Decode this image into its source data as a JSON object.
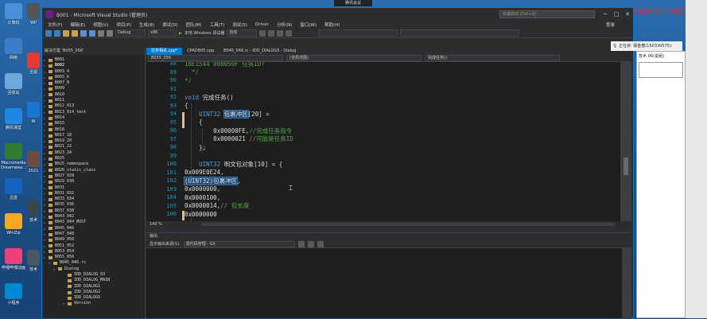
{
  "desktop": {
    "icons": [
      {
        "label": "计算机",
        "color": "#4a90d9"
      },
      {
        "label": "网络",
        "color": "#3d7cc9"
      },
      {
        "label": "回收站",
        "color": "#6fa8dc"
      },
      {
        "label": "腾讯课堂",
        "color": "#1e88e5"
      },
      {
        "label": "Macromedia Dreamwea...",
        "color": "#2e7d32"
      },
      {
        "label": "迅雷",
        "color": "#1565c0"
      },
      {
        "label": "WinZip",
        "color": "#f9a825"
      },
      {
        "label": "哔哩哔哩动画",
        "color": "#ec407a"
      },
      {
        "label": "小程序",
        "color": "#0288d1"
      }
    ],
    "icons2": [
      {
        "label": "WP",
        "color": "#555555"
      },
      {
        "label": "迅视",
        "color": "#e53935"
      },
      {
        "label": "W",
        "color": "#1976d2"
      },
      {
        "label": "2021",
        "color": "#6d4c41"
      },
      {
        "label": "技术",
        "color": "#37474f"
      },
      {
        "label": "技术",
        "color": "#455a64"
      }
    ]
  },
  "overlay": {
    "meeting": "腾讯会议",
    "qq": "QQ150330575"
  },
  "chat": {
    "text": "正在讲:",
    "name": "鄢金春(150330575):"
  },
  "winbox": {
    "title": "技术 0R(说组)"
  },
  "vs": {
    "title": "B001 - Microsoft Visual Studio (管理员)",
    "quick_launch": "快速启动 (Ctrl+Q)",
    "menu": [
      "文件(F)",
      "编辑(E)",
      "视图(V)",
      "项目(P)",
      "生成(B)",
      "调试(D)",
      "团队(M)",
      "工具(T)",
      "测试(S)",
      "Driver",
      "分析(N)",
      "窗口(W)",
      "帮助(H)"
    ],
    "login": "登录",
    "toolbar": {
      "config": "Debug",
      "platform": "x86",
      "debugger": "本地 Windows 调试器",
      "mode": "自动"
    },
    "solution": {
      "title": "解决方案 'B055_056'",
      "items": [
        {
          "text": "B001",
          "arrow": "▸",
          "bold": false
        },
        {
          "text": "B002",
          "arrow": "▸",
          "bold": true
        },
        {
          "text": "B003_4",
          "arrow": "▸",
          "bold": false
        },
        {
          "text": "B005_6",
          "arrow": "▸",
          "bold": false
        },
        {
          "text": "B007_8",
          "arrow": "▸",
          "bold": false
        },
        {
          "text": "B009",
          "arrow": "▸",
          "bold": false
        },
        {
          "text": "B010",
          "arrow": "▸",
          "bold": false
        },
        {
          "text": "B011",
          "arrow": "▸",
          "bold": false
        },
        {
          "text": "B012_013",
          "arrow": "▸",
          "bold": false
        },
        {
          "text": "B013_014_test",
          "arrow": "▸",
          "bold": false
        },
        {
          "text": "B014",
          "arrow": "▸",
          "bold": false
        },
        {
          "text": "B015",
          "arrow": "▸",
          "bold": false
        },
        {
          "text": "B016",
          "arrow": "▸",
          "bold": false
        },
        {
          "text": "B017_18",
          "arrow": "▸",
          "bold": false
        },
        {
          "text": "B019_20",
          "arrow": "▸",
          "bold": false
        },
        {
          "text": "B021_22",
          "arrow": "▸",
          "bold": false
        },
        {
          "text": "B023_24",
          "arrow": "▸",
          "bold": false
        },
        {
          "text": "B025",
          "arrow": "▸",
          "bold": false
        },
        {
          "text": "B025_namespace",
          "arrow": "▸",
          "bold": false
        },
        {
          "text": "B026_static_class",
          "arrow": "▸",
          "bold": false
        },
        {
          "text": "B027_028",
          "arrow": "▸",
          "bold": false
        },
        {
          "text": "B029_030",
          "arrow": "▸",
          "bold": false
        },
        {
          "text": "B031",
          "arrow": "▸",
          "bold": false
        },
        {
          "text": "B031_032",
          "arrow": "▸",
          "bold": false
        },
        {
          "text": "B033_034",
          "arrow": "▸",
          "bold": false
        },
        {
          "text": "B035_036",
          "arrow": "▸",
          "bold": false
        },
        {
          "text": "B037_038",
          "arrow": "▸",
          "bold": false
        },
        {
          "text": "B043_042",
          "arrow": "▸",
          "bold": false
        },
        {
          "text": "B043_044_MUST",
          "arrow": "▸",
          "bold": false
        },
        {
          "text": "B045_046",
          "arrow": "▸",
          "bold": false
        },
        {
          "text": "B047_048",
          "arrow": "▸",
          "bold": false
        },
        {
          "text": "B049_050",
          "arrow": "▸",
          "bold": false
        },
        {
          "text": "B051_052",
          "arrow": "▸",
          "bold": false
        },
        {
          "text": "B053_054",
          "arrow": "▸",
          "bold": false
        },
        {
          "text": "B055_056",
          "arrow": "▾",
          "bold": false
        },
        {
          "text": "B045_046.rc",
          "arrow": "▾",
          "bold": false
        },
        {
          "text": "Dialog",
          "arrow": "▾",
          "bold": false
        },
        {
          "text": "IDD_DIALOG_03",
          "arrow": "",
          "bold": false
        },
        {
          "text": "IDD_DIALOG_MAIN",
          "arrow": "",
          "bold": false
        },
        {
          "text": "IDD_DIALOG1",
          "arrow": "",
          "bold": false
        },
        {
          "text": "IDD_DIALOG2",
          "arrow": "",
          "bold": false
        },
        {
          "text": "IDD_DIALOG5",
          "arrow": "",
          "bold": false
        },
        {
          "text": "Version",
          "arrow": "▸",
          "bold": false
        }
      ]
    },
    "tabs": [
      "任务相关.cpp*",
      "CPADB05.cpp",
      "B045_046.rc - IDD_DIALOG5 - Dialog"
    ],
    "nav": {
      "project": "B055_056",
      "scope": "(全局范围)",
      "member": "完成任务()"
    },
    "code": [
      {
        "n": "88",
        "text": "1BE1544 000050F 任务ID?",
        "cls": "cm"
      },
      {
        "n": "89",
        "text": "  */",
        "cls": "cm"
      },
      {
        "n": "90",
        "text": "*/",
        "cls": "cm"
      },
      {
        "n": "91",
        "text": "",
        "cls": ""
      },
      {
        "n": "92",
        "text": "void 完成任务()",
        "cls": "fn"
      },
      {
        "n": "93",
        "text": "{",
        "cls": ""
      },
      {
        "n": "94",
        "text": "    UINT32 包裹冲区[20] =",
        "cls": "decl1"
      },
      {
        "n": "95",
        "text": "    {",
        "cls": ""
      },
      {
        "n": "96",
        "text": "        0x00000FE,//完成任务指令",
        "cls": "c1"
      },
      {
        "n": "97",
        "text": "        0x0000021 //可能是任务ID",
        "cls": "c2"
      },
      {
        "n": "98",
        "text": "    };",
        "cls": ""
      },
      {
        "n": "99",
        "text": "",
        "cls": ""
      },
      {
        "n": "100",
        "text": "    UINT32 明文包对象[10] = {",
        "cls": "decl2"
      },
      {
        "n": "101",
        "text": "0x009E0E24,",
        "cls": ""
      },
      {
        "n": "102",
        "text": "(UINT32)包裹冲区,",
        "cls": "cast"
      },
      {
        "n": "103",
        "text": "0x0000000,",
        "cls": ""
      },
      {
        "n": "104",
        "text": "0x0000100,",
        "cls": ""
      },
      {
        "n": "105",
        "text": "0x0000014,// 包长度",
        "cls": "c3"
      },
      {
        "n": "106",
        "text": "0x0000000",
        "cls": ""
      }
    ],
    "zoom": "140 %",
    "output": {
      "title": "输出",
      "source_label": "显示输出来源(S):",
      "source": "源代码管理 - Git"
    }
  }
}
